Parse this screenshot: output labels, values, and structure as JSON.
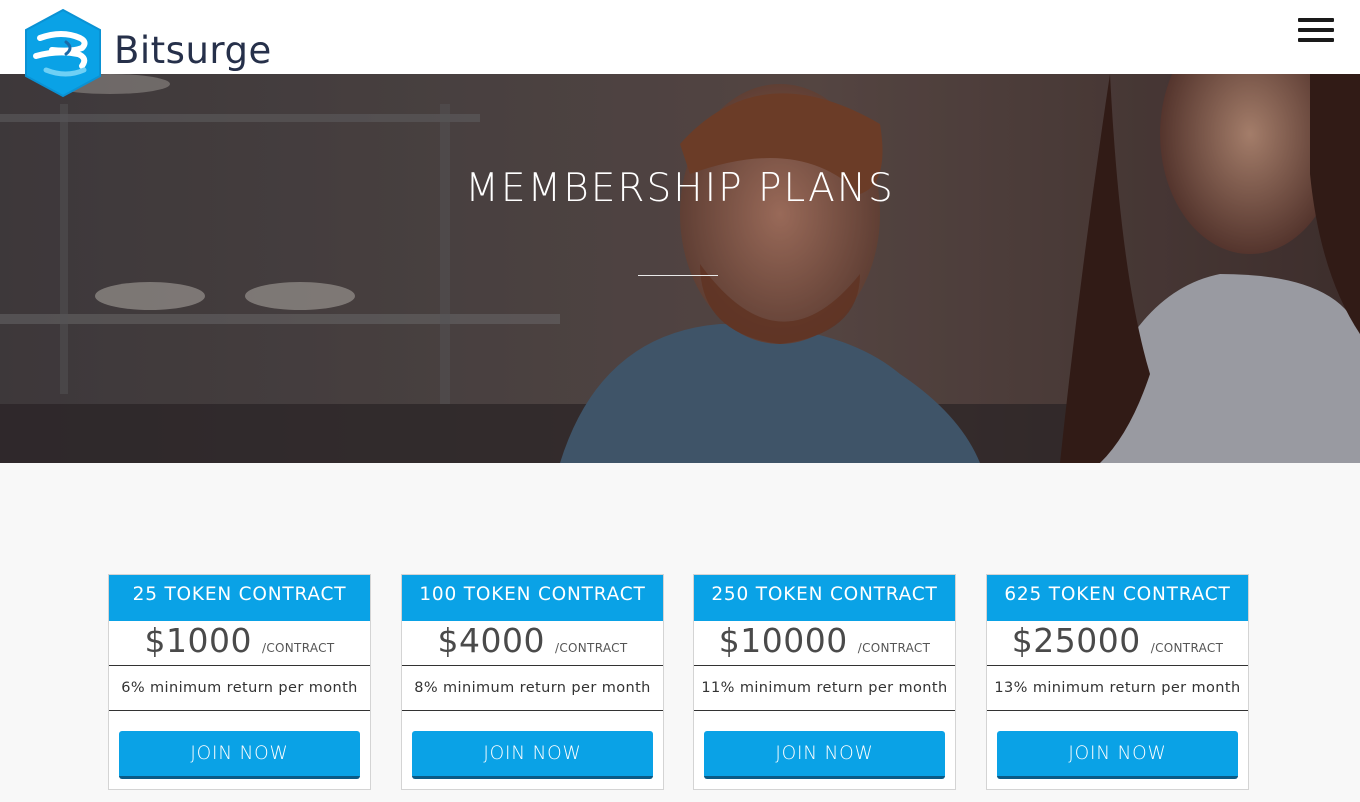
{
  "header": {
    "brand": "Bitsurge",
    "menu_icon": "hamburger-menu-icon",
    "logo_color": "#0aa2e6"
  },
  "hero": {
    "title": "MEMBERSHIP PLANS"
  },
  "plans": [
    {
      "title": "25 TOKEN CONTRACT",
      "price": "$1000",
      "unit": "/CONTRACT",
      "return": "6% minimum return per month",
      "button": "JOIN NOW"
    },
    {
      "title": "100 TOKEN CONTRACT",
      "price": "$4000",
      "unit": "/CONTRACT",
      "return": "8% minimum return per month",
      "button": "JOIN NOW"
    },
    {
      "title": "250 TOKEN CONTRACT",
      "price": "$10000",
      "unit": "/CONTRACT",
      "return": "11% minimum return per month",
      "button": "JOIN NOW"
    },
    {
      "title": "625 TOKEN CONTRACT",
      "price": "$25000",
      "unit": "/CONTRACT",
      "return": "13% minimum return per month",
      "button": "JOIN NOW"
    }
  ],
  "colors": {
    "accent": "#0aa2e6",
    "button_shadow": "#0a5a86",
    "brand_text": "#26304a"
  }
}
